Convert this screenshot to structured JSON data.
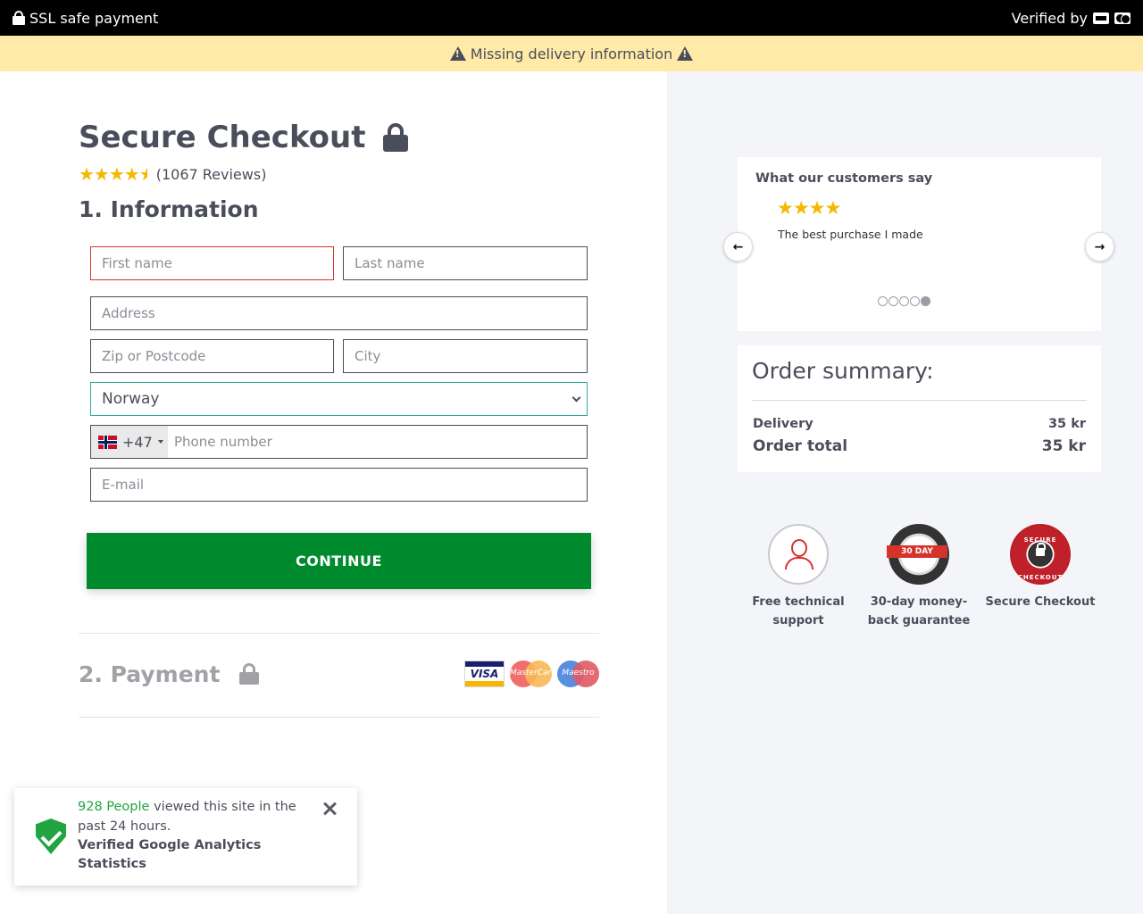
{
  "topbar": {
    "ssl_text": "SSL safe payment",
    "verified_text": "Verified by"
  },
  "warning": {
    "text": "Missing delivery information"
  },
  "checkout": {
    "title": "Secure Checkout",
    "rating_stars": 4.5,
    "reviews_text": "(1067 Reviews)",
    "section_title": "1. Information",
    "fields": {
      "first_name": "First name",
      "last_name": "Last name",
      "address": "Address",
      "zip": "Zip or Postcode",
      "city": "City",
      "country": "Norway",
      "phone_code": "+47",
      "phone": "Phone number",
      "email": "E-mail"
    },
    "continue_label": "CONTINUE",
    "payment_title": "2. Payment",
    "cards": [
      "VISA",
      "MasterCard",
      "Maestro"
    ]
  },
  "reviews": {
    "heading": "What our customers say",
    "quote": "The best purchase I made",
    "prev": "🡐",
    "next": "🡒",
    "dots_total": 5,
    "dots_active_index": 4
  },
  "summary": {
    "title": "Order summary:",
    "delivery_label": "Delivery",
    "delivery_value": "35 kr",
    "total_label": "Order total",
    "total_value": "35 kr"
  },
  "badges": {
    "support": "Free technical support",
    "money_back": "30-day money-back guarantee",
    "money_ribbon": "30 DAY",
    "secure": "Secure Checkout",
    "secure_top": "SECURE",
    "secure_bottom": "CHECKOUT"
  },
  "toast": {
    "count_text": "928 People",
    "rest_text": " viewed this site in the past 24 hours.",
    "bold_text": "Verified Google Analytics Statistics"
  },
  "colors": {
    "primary_green": "#008a2e",
    "warning_bg": "#ffeaa8",
    "error_red": "#d6342a",
    "star_yellow": "#f5b800"
  }
}
